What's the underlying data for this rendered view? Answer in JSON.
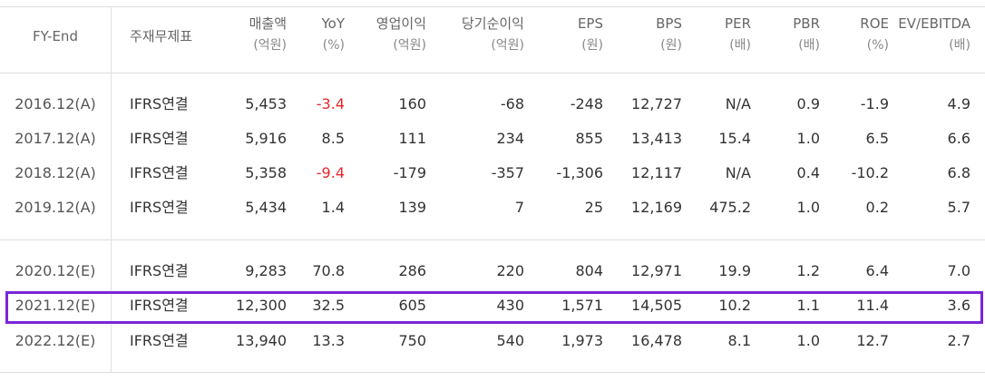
{
  "header": {
    "fy_end": "FY-End",
    "statement": "주재무제표",
    "cols": [
      {
        "label": "매출액",
        "unit": "(억원)"
      },
      {
        "label": "YoY",
        "unit": "(%)"
      },
      {
        "label": "영업이익",
        "unit": "(억원)"
      },
      {
        "label": "당기순이익",
        "unit": "(억원)"
      },
      {
        "label": "EPS",
        "unit": "(원)"
      },
      {
        "label": "BPS",
        "unit": "(원)"
      },
      {
        "label": "PER",
        "unit": "(배)"
      },
      {
        "label": "PBR",
        "unit": "(배)"
      },
      {
        "label": "ROE",
        "unit": "(%)"
      },
      {
        "label": "EV/EBITDA",
        "unit": "(배)"
      }
    ]
  },
  "rows": [
    {
      "date": "2016.12(A)",
      "type": "IFRS연결",
      "vals": [
        "5,453",
        "-3.4",
        "160",
        "-68",
        "-248",
        "12,727",
        "N/A",
        "0.9",
        "-1.9",
        "4.9"
      ],
      "neg_yoy": true
    },
    {
      "date": "2017.12(A)",
      "type": "IFRS연결",
      "vals": [
        "5,916",
        "8.5",
        "111",
        "234",
        "855",
        "13,413",
        "15.4",
        "1.0",
        "6.5",
        "6.6"
      ],
      "neg_yoy": false
    },
    {
      "date": "2018.12(A)",
      "type": "IFRS연결",
      "vals": [
        "5,358",
        "-9.4",
        "-179",
        "-357",
        "-1,306",
        "12,117",
        "N/A",
        "0.4",
        "-10.2",
        "6.8"
      ],
      "neg_yoy": true
    },
    {
      "date": "2019.12(A)",
      "type": "IFRS연결",
      "vals": [
        "5,434",
        "1.4",
        "139",
        "7",
        "25",
        "12,169",
        "475.2",
        "1.0",
        "0.2",
        "5.7"
      ],
      "neg_yoy": false
    },
    {
      "date": "2020.12(E)",
      "type": "IFRS연결",
      "vals": [
        "9,283",
        "70.8",
        "286",
        "220",
        "804",
        "12,971",
        "19.9",
        "1.2",
        "6.4",
        "7.0"
      ],
      "neg_yoy": false
    },
    {
      "date": "2021.12(E)",
      "type": "IFRS연결",
      "vals": [
        "12,300",
        "32.5",
        "605",
        "430",
        "1,571",
        "14,505",
        "10.2",
        "1.1",
        "11.4",
        "3.6"
      ],
      "neg_yoy": false
    },
    {
      "date": "2022.12(E)",
      "type": "IFRS연결",
      "vals": [
        "13,940",
        "13.3",
        "750",
        "540",
        "1,973",
        "16,478",
        "8.1",
        "1.0",
        "12.7",
        "2.7"
      ],
      "neg_yoy": false
    }
  ],
  "colors": {
    "negative": "#e8262b",
    "highlight": "#7b25d8"
  }
}
